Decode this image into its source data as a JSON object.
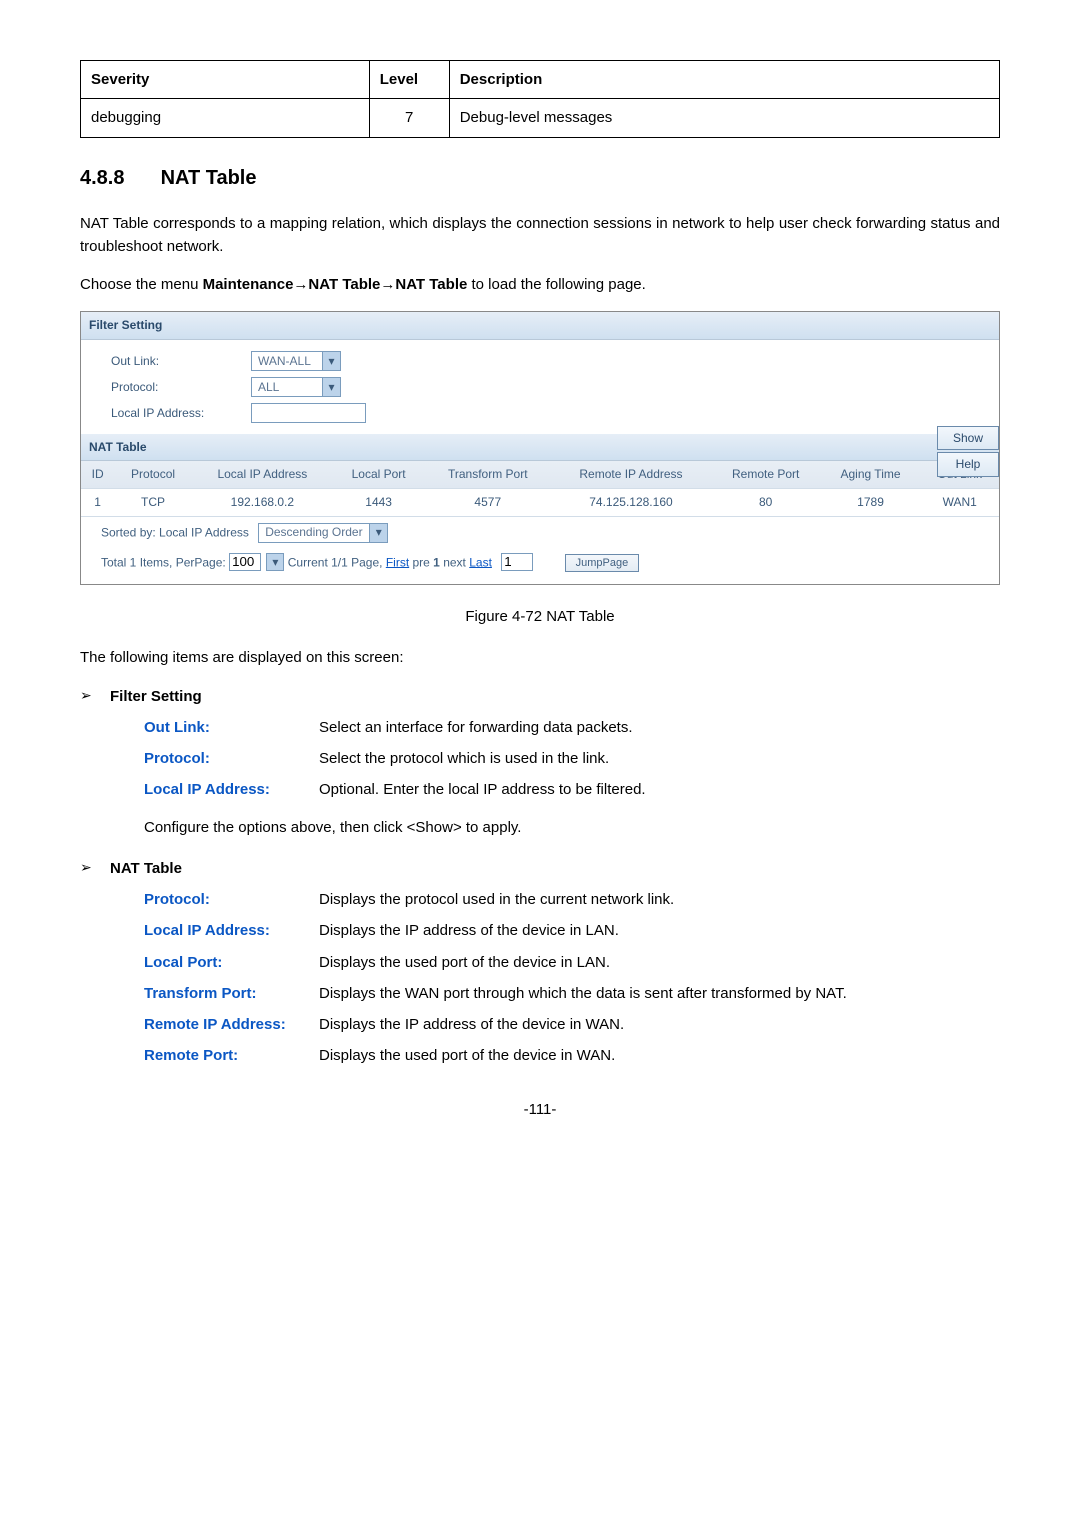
{
  "severity_table": {
    "headers": [
      "Severity",
      "Level",
      "Description"
    ],
    "row": {
      "severity": "debugging",
      "level": "7",
      "description": "Debug-level messages"
    }
  },
  "section": {
    "number": "4.8.8",
    "title": "NAT Table"
  },
  "intro": "NAT Table corresponds to a mapping relation, which displays the connection sessions in network to help user check forwarding status and troubleshoot network.",
  "menu_sentence_prefix": "Choose the menu ",
  "menu_path": "Maintenance→NAT Table→NAT Table",
  "menu_sentence_suffix": " to load the following page.",
  "ui": {
    "filter_setting_title": "Filter Setting",
    "labels": {
      "out_link": "Out Link:",
      "protocol": "Protocol:",
      "local_ip": "Local IP Address:"
    },
    "selects": {
      "out_link": "WAN-ALL",
      "protocol": "ALL"
    },
    "buttons": {
      "show": "Show",
      "help": "Help",
      "jump": "JumpPage"
    },
    "nat_title": "NAT Table",
    "nat_headers": [
      "ID",
      "Protocol",
      "Local IP Address",
      "Local Port",
      "Transform Port",
      "Remote IP Address",
      "Remote Port",
      "Aging Time",
      "Out Link"
    ],
    "nat_row": [
      "1",
      "TCP",
      "192.168.0.2",
      "1443",
      "4577",
      "74.125.128.160",
      "80",
      "1789",
      "WAN1"
    ],
    "sort_prefix": "Sorted by: Local IP Address",
    "sort_order": "Descending Order",
    "pager_total": "Total 1 Items, PerPage:",
    "per_page": "100",
    "pager_mid_a": "Current 1/1 Page, ",
    "first": "First",
    "pre": " pre ",
    "one": "1",
    "next": " next ",
    "last": "Last",
    "page_in": "1"
  },
  "figure_caption": "Figure 4-72 NAT Table",
  "display_intro": "The following items are displayed on this screen:",
  "bullets": {
    "filter": "Filter Setting",
    "nat": "NAT Table"
  },
  "filter_defs": {
    "out_link": {
      "label": "Out Link:",
      "desc": "Select an interface for forwarding data packets."
    },
    "protocol": {
      "label": "Protocol:",
      "desc": "Select the protocol which is used in the link."
    },
    "local_ip": {
      "label": "Local IP Address:",
      "desc": "Optional. Enter the local IP address to be filtered."
    }
  },
  "config_note": "Configure the options above, then click <Show> to apply.",
  "nat_defs": {
    "protocol": {
      "label": "Protocol:",
      "desc": "Displays the protocol used in the current network link."
    },
    "local_ip": {
      "label": "Local IP Address:",
      "desc": "Displays the IP address of the device in LAN."
    },
    "local_port": {
      "label": "Local Port:",
      "desc": "Displays the used port of the device in LAN."
    },
    "transform_port": {
      "label": "Transform Port:",
      "desc": "Displays the WAN port through which the data is sent after transformed by NAT."
    },
    "remote_ip": {
      "label": "Remote IP Address:",
      "desc": "Displays the IP address of the device in WAN."
    },
    "remote_port": {
      "label": "Remote Port:",
      "desc": "Displays the used port of the device in WAN."
    }
  },
  "page_number": "-111-"
}
